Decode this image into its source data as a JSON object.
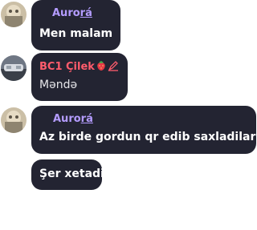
{
  "messages": [
    {
      "author": "Aurora",
      "author_prefix": "Auro",
      "author_suffix": "rá",
      "text": "Men malam"
    },
    {
      "author": "BC1 Çilek",
      "author_main": "BC1 Çilek",
      "text": "Məndə"
    },
    {
      "author": "Aurora",
      "author_prefix": "Auro",
      "author_suffix": "rá",
      "text": "Az birde gordun qr edib saxladilar"
    },
    {
      "text": "Şer xetadilar"
    }
  ],
  "colors": {
    "bubble": "#232432",
    "aurora_name": "#b49cff",
    "bc_name": "#ff5c6c",
    "text": "#ffffff"
  },
  "icons": {
    "strawberry": "strawberry-icon",
    "pencil_edit": "pencil-edit-icon"
  }
}
